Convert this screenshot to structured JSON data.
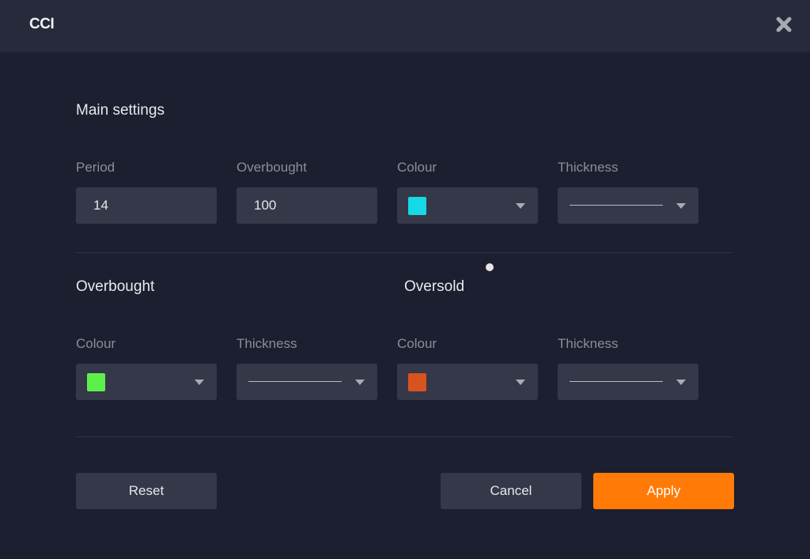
{
  "dialog": {
    "title": "CCI",
    "close_icon": "close-x-icon"
  },
  "main_settings": {
    "title": "Main settings",
    "period": {
      "label": "Period",
      "value": "14"
    },
    "overbought": {
      "label": "Overbought",
      "value": "100"
    },
    "colour": {
      "label": "Colour",
      "value": "#17d9e6"
    },
    "thickness": {
      "label": "Thickness",
      "value": "thin-line"
    }
  },
  "overbought": {
    "title": "Overbought",
    "colour": {
      "label": "Colour",
      "value": "#5ef04a"
    },
    "thickness": {
      "label": "Thickness",
      "value": "thin-line"
    }
  },
  "oversold": {
    "title": "Oversold",
    "colour": {
      "label": "Colour",
      "value": "#d9531f"
    },
    "thickness": {
      "label": "Thickness",
      "value": "thin-line"
    }
  },
  "buttons": {
    "reset": "Reset",
    "cancel": "Cancel",
    "apply": "Apply"
  },
  "colors": {
    "accent": "#ff7a06",
    "background": "#1c1f2f",
    "header": "#262a3b",
    "field": "#353849"
  }
}
